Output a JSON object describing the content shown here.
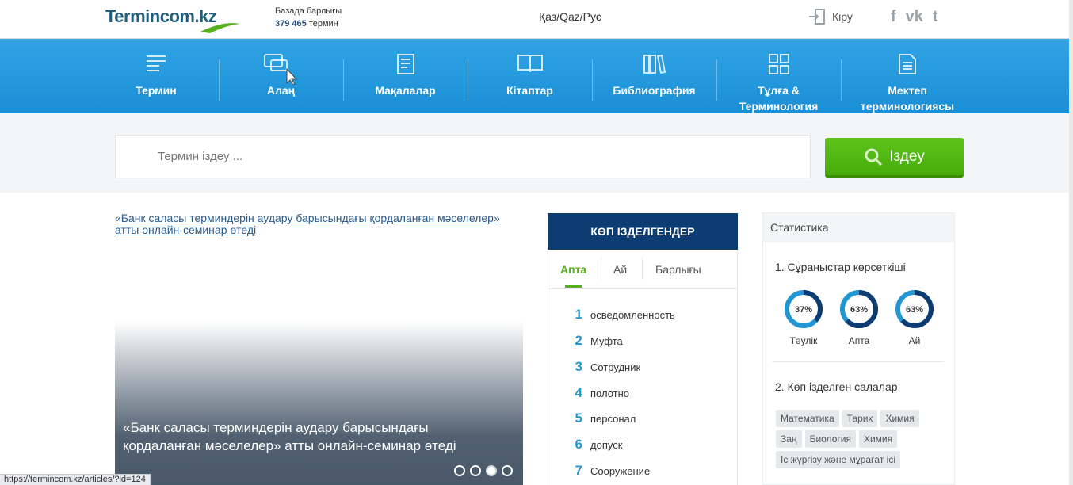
{
  "header": {
    "logo_text": "Termincom.kz",
    "base_label": "Базада барлығы",
    "base_count": "379 465",
    "base_unit": "термин",
    "languages": "Қаз/Qaz/Рус",
    "login_label": "Кіру",
    "socials": [
      "f",
      "vk",
      "t"
    ]
  },
  "nav": {
    "items": [
      {
        "label": "Термин",
        "icon": "list-icon"
      },
      {
        "label": "Алаң",
        "icon": "chat-icon"
      },
      {
        "label": "Мақалалар",
        "icon": "article-icon"
      },
      {
        "label": "Кітаптар",
        "icon": "book-icon"
      },
      {
        "label": "Библиография",
        "icon": "library-icon"
      },
      {
        "label": "Тұлға &",
        "label2": "Терминология",
        "icon": "grid-icon"
      },
      {
        "label": "Мектеп",
        "label2": "терминологиясы",
        "icon": "document-icon"
      }
    ]
  },
  "search": {
    "placeholder": "Термин іздеу ...",
    "button_label": "Іздеу"
  },
  "slider": {
    "alt_text": "«Банк саласы терминдерін аудару барысындағы қордаланған мәселелер» атты онлайн-семинар өтеді",
    "caption": "«Банк саласы терминдерін аудару барысындағы қордаланған мәселелер» атты онлайн-семинар өтеді",
    "dots": 4,
    "active_dot": 3,
    "status_url": "https://termincom.kz/articles/?id=124"
  },
  "popular": {
    "title": "КӨП ІЗДЕЛГЕНДЕР",
    "tabs": [
      "Апта",
      "Ай",
      "Барлығы"
    ],
    "active_tab": 0,
    "items": [
      {
        "num": "1",
        "word": "осведомленность"
      },
      {
        "num": "2",
        "word": "Муфта"
      },
      {
        "num": "3",
        "word": "Сотрудник"
      },
      {
        "num": "4",
        "word": "полотно"
      },
      {
        "num": "5",
        "word": "персонал"
      },
      {
        "num": "6",
        "word": "допуск"
      },
      {
        "num": "7",
        "word": "Сооружение"
      }
    ]
  },
  "stats": {
    "title": "Статистика",
    "section1": "1. Сұраныстар көрсеткіші",
    "donuts": [
      {
        "percent": 37,
        "text": "37%",
        "label": "Тәулік"
      },
      {
        "percent": 63,
        "text": "63%",
        "label": "Апта"
      },
      {
        "percent": 63,
        "text": "63%",
        "label": "Ай"
      }
    ],
    "section2": "2. Көп ізделген салалар",
    "tags": [
      "Математика",
      "Тарих",
      "Химия",
      "Заң",
      "Биология",
      "Химия",
      "Іс жүргізу және мұрағат ісі"
    ]
  },
  "colors": {
    "nav_blue": "#1f98dc",
    "popular_head": "#0d3c72",
    "accent_green": "#55b11e",
    "donut_dark": "#0d3c72",
    "donut_light": "#2196d3"
  }
}
